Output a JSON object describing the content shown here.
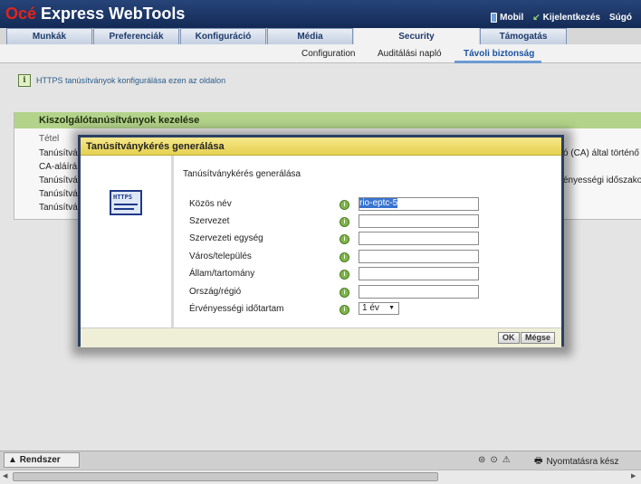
{
  "header": {
    "brand_red": "Océ",
    "brand_white": " Express WebTools",
    "links": {
      "mobile": "Mobil",
      "logout": "Kijelentkezés",
      "help": "Súgó"
    }
  },
  "tabs": [
    "Munkák",
    "Preferenciák",
    "Konfiguráció",
    "Média",
    "Security",
    "Támogatás"
  ],
  "active_tab": "Security",
  "subtabs": [
    "Configuration",
    "Auditálási napló",
    "Távoli biztonság"
  ],
  "active_subtab": "Távoli biztonság",
  "info_text": "HTTPS tanúsítványok konfigurálása ezen az oldalon",
  "panel": {
    "header": "Kiszolgálótanúsítványok kezelése",
    "column": "Tétel",
    "rows": [
      "Tanúsítvá",
      "CA-aláírá",
      "Tanúsítvá",
      "Tanúsítvá",
      "Tanúsítvá"
    ],
    "right_texts": [
      "ó (CA) által történő",
      "ényességi időszakot"
    ]
  },
  "modal": {
    "title": "Tanúsítványkérés generálása",
    "section_title": "Tanúsítványkérés generálása",
    "icon_label": "HTTPS",
    "fields": [
      {
        "label": "Közös név",
        "value": "rio-eptc-5"
      },
      {
        "label": "Szervezet",
        "value": ""
      },
      {
        "label": "Szervezeti egység",
        "value": ""
      },
      {
        "label": "Város/település",
        "value": ""
      },
      {
        "label": "Állam/tartomány",
        "value": ""
      },
      {
        "label": "Ország/régió",
        "value": ""
      }
    ],
    "validity": {
      "label": "Érvényességi időtartam",
      "value": "1 év"
    },
    "buttons": {
      "ok": "OK",
      "cancel": "Mégse"
    }
  },
  "bottom": {
    "system_tab": "Rendszer",
    "status": "Nyomtatásra kész"
  }
}
